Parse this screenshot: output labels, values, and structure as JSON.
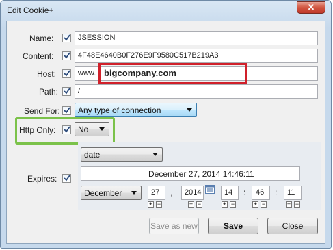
{
  "window": {
    "title": "Edit Cookie+",
    "close_glyph": "✕"
  },
  "fields": {
    "name": {
      "label": "Name:",
      "value": "JSESSION"
    },
    "content": {
      "label": "Content:",
      "value": "4F48E4640B0F276E9F9580C517B219A3"
    },
    "host": {
      "label": "Host:",
      "prefix": "www.",
      "value": "bigcompany.com"
    },
    "path": {
      "label": "Path:",
      "value": "/"
    },
    "send_for": {
      "label": "Send For:",
      "selected": "Any type of connection"
    },
    "http_only": {
      "label": "Http Only:",
      "selected": "No"
    },
    "expires": {
      "label": "Expires:",
      "mode": "date",
      "display": "December 27, 2014 14:46:11",
      "month": "December",
      "day": "27",
      "day_sep": ",",
      "year": "2014",
      "hour": "14",
      "minute": "46",
      "second": "11",
      "time_sep": ":"
    }
  },
  "buttons": {
    "save_as_new": "Save as new",
    "save": "Save",
    "close": "Close"
  },
  "icons": {
    "check": "check-icon",
    "calendar": "calendar-icon",
    "dropdown": "chevron-down-icon",
    "plus": "+",
    "minus": "−"
  },
  "colors": {
    "highlight_red": "#d0202a",
    "highlight_green": "#7bc24a",
    "title_bar": "#c6d9ec"
  }
}
